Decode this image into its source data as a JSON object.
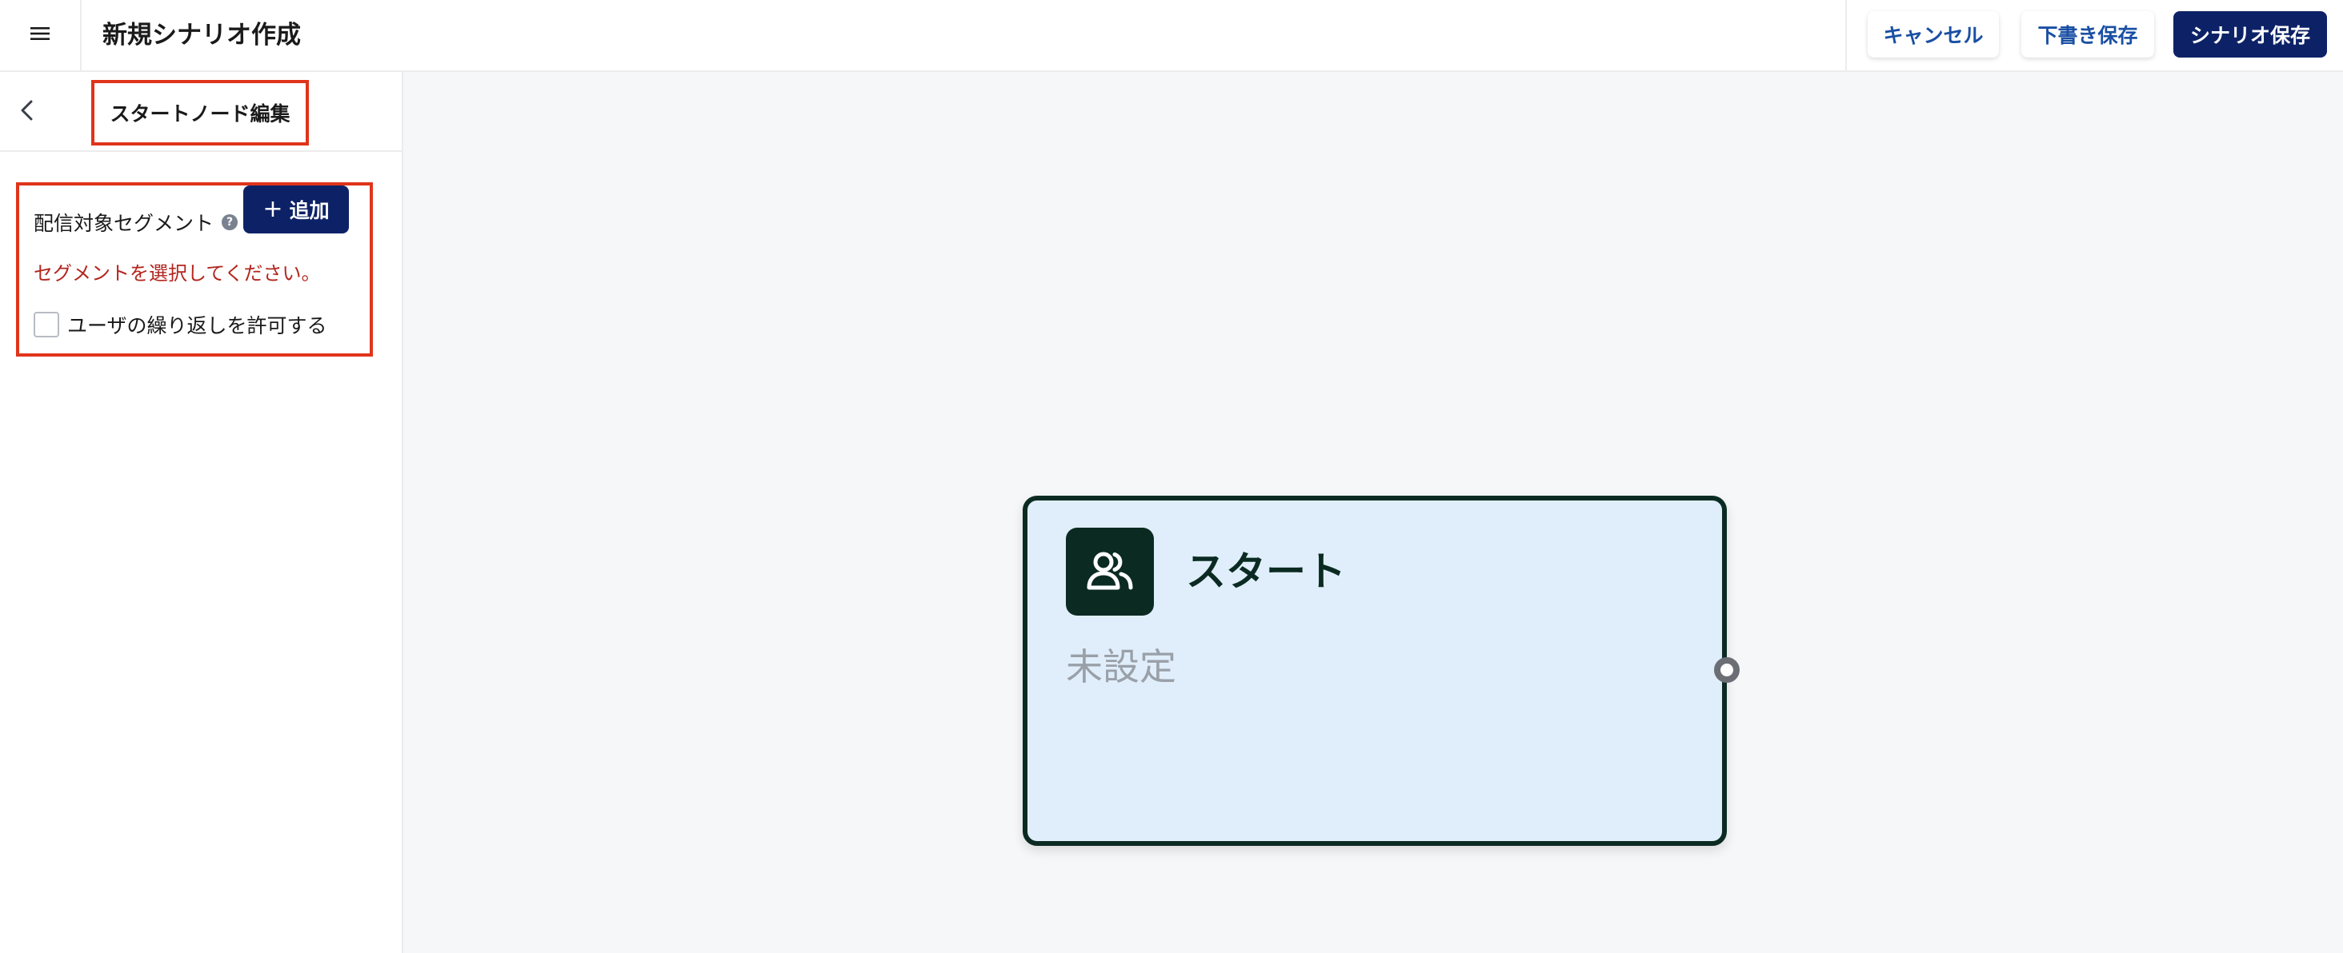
{
  "header": {
    "title": "新規シナリオ作成",
    "menu_icon": "hamburger-menu-icon",
    "cancel_label": "キャンセル",
    "draft_label": "下書き保存",
    "save_label": "シナリオ保存"
  },
  "sidebar": {
    "title": "スタートノード編集",
    "back_icon": "chevron-left-icon",
    "segment_label": "配信対象セグメント",
    "help_glyph": "?",
    "add_label": "追加",
    "add_glyph": "+",
    "error_message": "セグメントを選択してください。",
    "repeat_label": "ユーザの繰り返しを許可する",
    "repeat_checked": false
  },
  "node": {
    "title": "スタート",
    "status": "未設定",
    "icon": "users-icon"
  },
  "colors": {
    "primary": "#0d2266",
    "link": "#1a4fa3",
    "error": "#b3261e",
    "highlight": "#e0341b",
    "node_dark": "#0b2b22",
    "node_bg": "#e0eefb",
    "canvas_bg": "#f6f7f9"
  }
}
